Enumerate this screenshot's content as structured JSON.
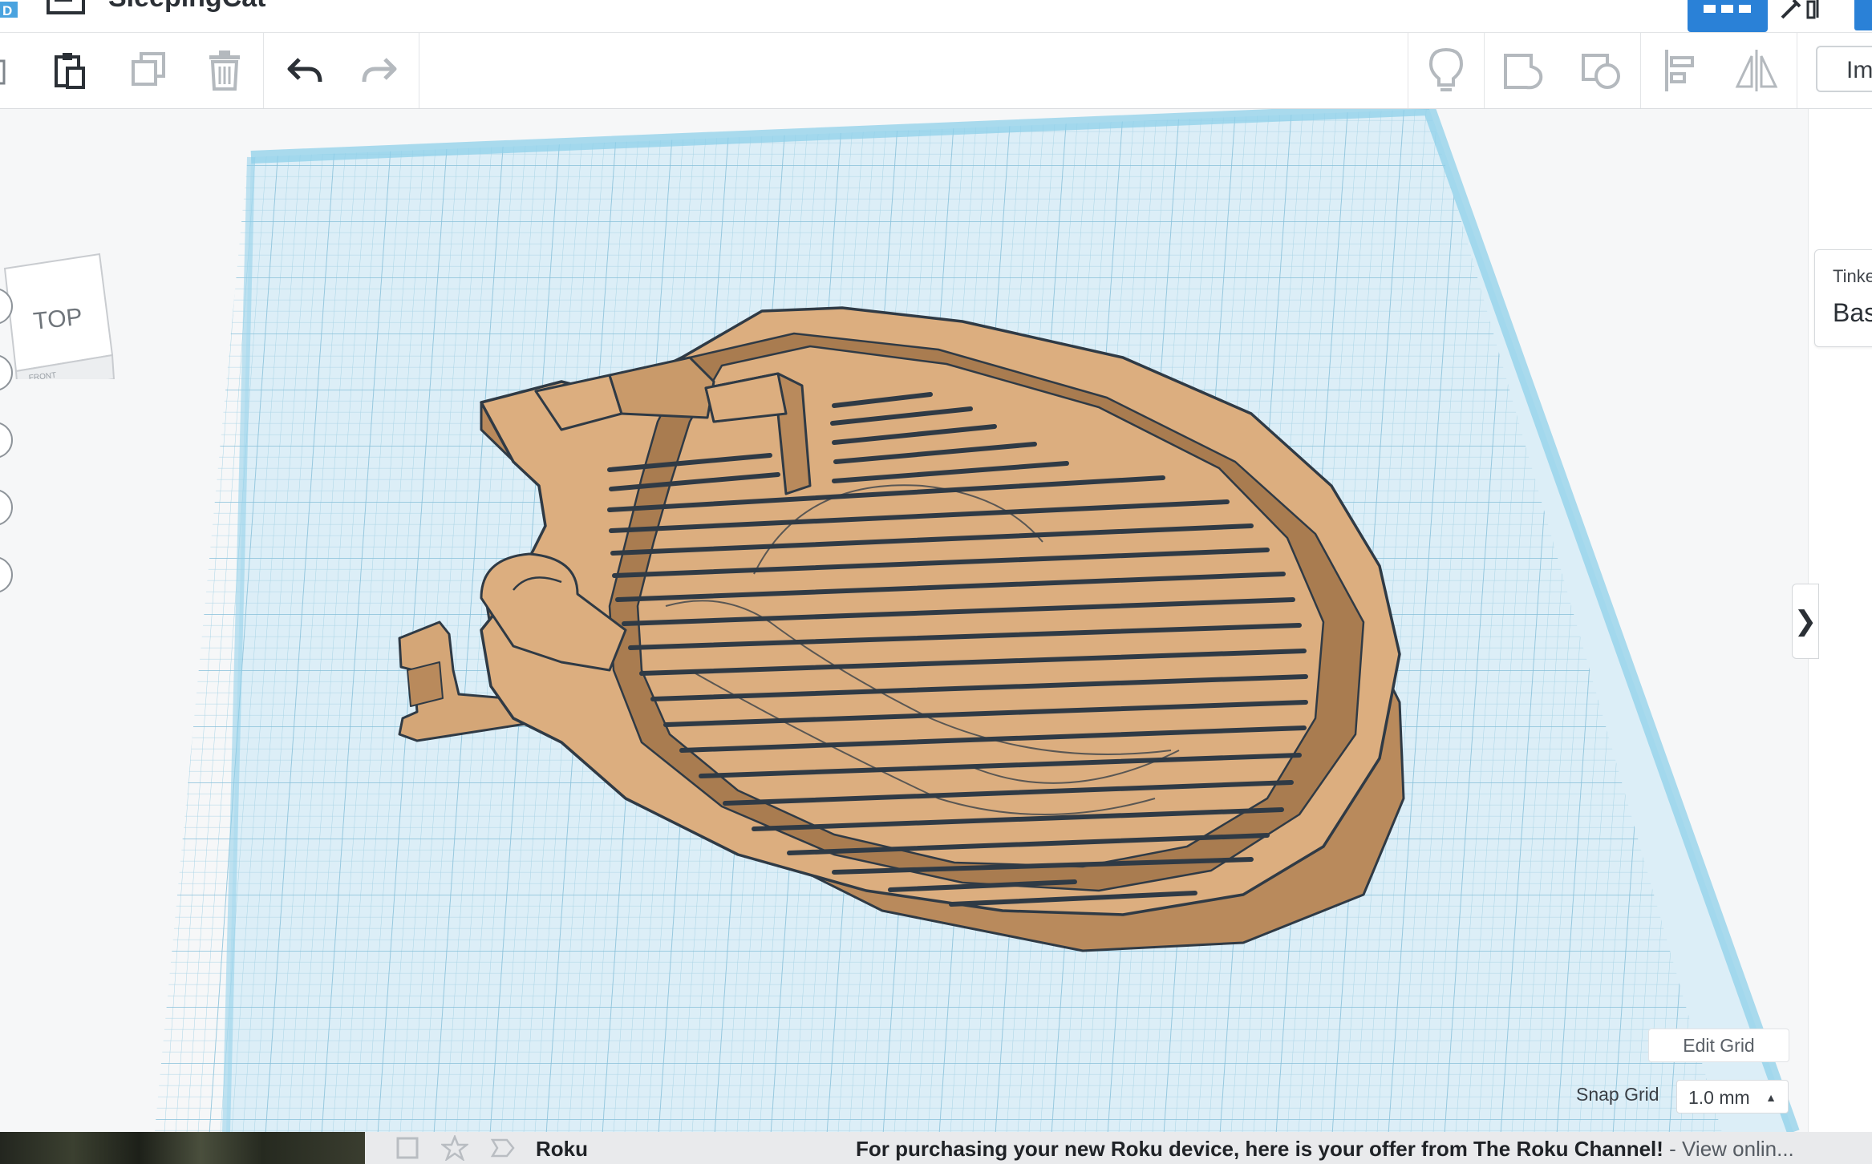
{
  "app": {
    "design_name": "SleepingCat"
  },
  "toolbar": {
    "copy_icon": "copy-icon",
    "paste_icon": "paste-icon",
    "duplicate_icon": "duplicate-icon",
    "delete_icon": "trash-icon",
    "undo_icon": "undo-icon",
    "redo_icon": "redo-icon",
    "notes_icon": "lightbulb-icon",
    "group_icon": "group-icon",
    "ungroup_icon": "ungroup-icon",
    "align_icon": "align-icon",
    "mirror_icon": "mirror-icon",
    "import_label": "Im"
  },
  "view_cube": {
    "face_top": "TOP",
    "face_front": "FRONT"
  },
  "right_panel": {
    "brand_label": "Tinke",
    "category_label": "Bas"
  },
  "grid": {
    "edit_grid_label": "Edit Grid",
    "snap_grid_label": "Snap Grid",
    "snap_grid_value": "1.0 mm"
  },
  "notification": {
    "sender": "Roku",
    "subject": "For purchasing your new Roku device, here is your offer from The Roku Channel!",
    "snippet": " - View onlin..."
  },
  "colors": {
    "accent": "#2a81d7",
    "workplane_fill": "#d9edf6",
    "workplane_edge": "#8fd0ea",
    "model_fill": "#d9ac7e",
    "model_shadow": "#b98a5c",
    "model_outline": "#2f3a45"
  }
}
